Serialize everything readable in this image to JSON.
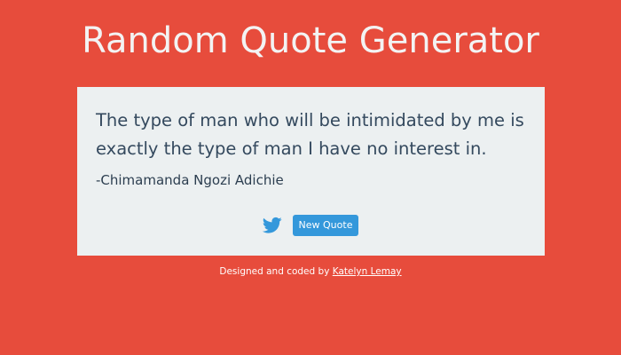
{
  "header": {
    "title": "Random Quote Generator"
  },
  "quote": {
    "text": "The type of man who will be intimidated by me is exactly the type of man I have no interest in.",
    "author": "-Chimamanda Ngozi Adichie"
  },
  "actions": {
    "tweet_icon": "twitter-icon",
    "new_quote_label": "New Quote"
  },
  "footer": {
    "prefix": "Designed and coded by",
    "author_link": "Katelyn Lemay"
  },
  "colors": {
    "background": "#e74c3c",
    "card": "#ecf0f1",
    "text": "#34495e",
    "button": "#3498db",
    "twitter": "#3498db"
  }
}
